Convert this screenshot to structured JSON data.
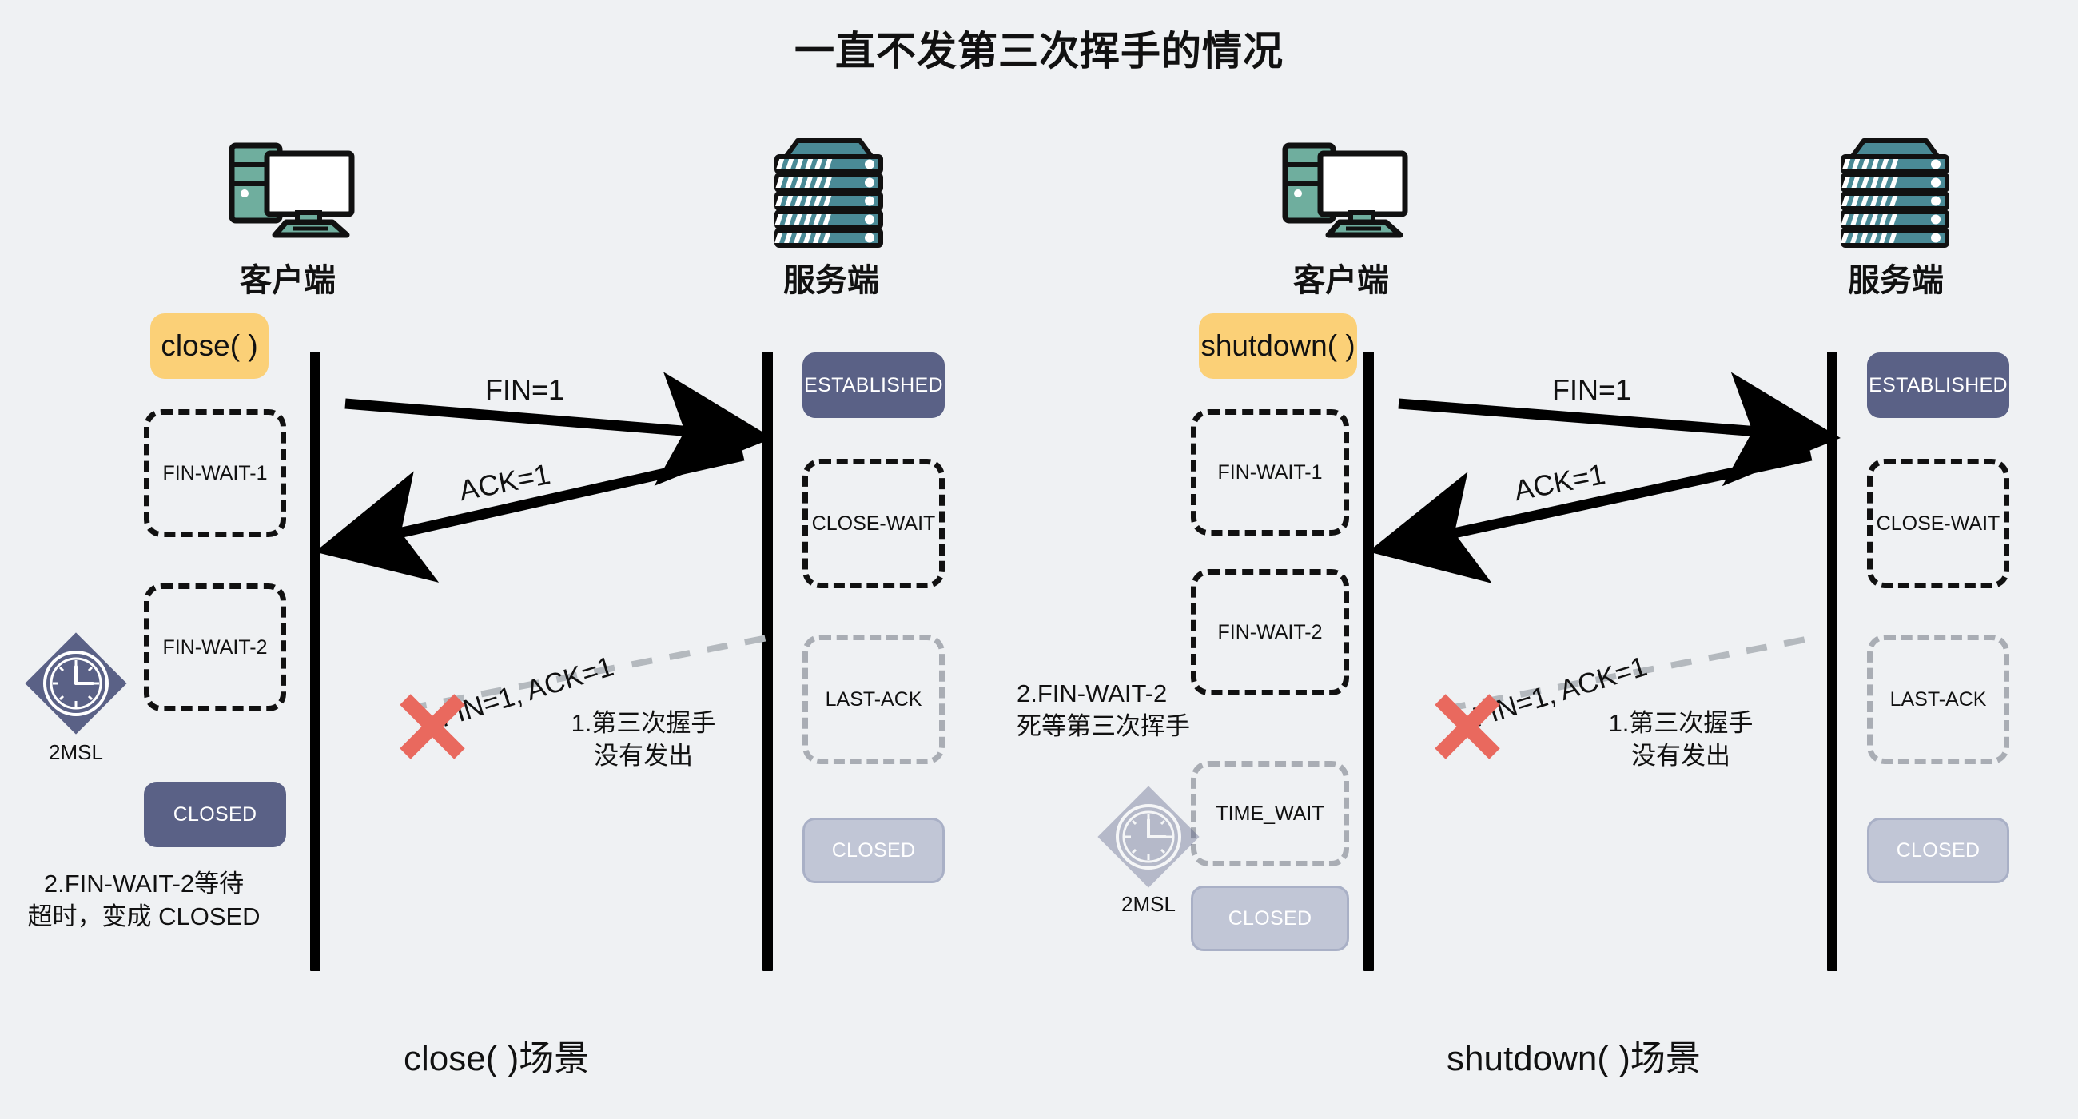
{
  "title": "一直不发第三次挥手的情况",
  "colors": {
    "background": "#eff1f3",
    "action_box": "#fbd077",
    "state_active": "#5a6186",
    "state_faded": "#c1c6d6",
    "dashed_active": "#111111",
    "dashed_muted": "#a9adb4",
    "cross_red": "#e9695e",
    "device_teal": "#6fae9e",
    "server_teal": "#4a8a96",
    "lifeline": "#000000"
  },
  "panels": [
    {
      "id": "close-scenario",
      "caption": "close( )场景",
      "client": {
        "label": "客户端",
        "icon": "desktop-computer-icon",
        "action": "close( )",
        "states": [
          {
            "name": "FIN-WAIT-1",
            "style": "dashed-active"
          },
          {
            "name": "FIN-WAIT-2",
            "style": "dashed-active"
          },
          {
            "name": "CLOSED",
            "style": "solid-active"
          }
        ],
        "timer": {
          "label": "2MSL",
          "icon": "clock-diamond-icon",
          "ghost": false
        },
        "note": [
          "2.FIN-WAIT-2等待",
          "超时，变成 CLOSED"
        ]
      },
      "server": {
        "label": "服务端",
        "icon": "server-rack-icon",
        "states": [
          {
            "name": "ESTABLISHED",
            "style": "solid-active"
          },
          {
            "name": "CLOSE-WAIT",
            "style": "dashed-active"
          },
          {
            "name": "LAST-ACK",
            "style": "dashed-muted"
          },
          {
            "name": "CLOSED",
            "style": "solid-faded"
          }
        ]
      },
      "messages": [
        {
          "label": "FIN=1",
          "direction": "client-to-server",
          "style": "solid"
        },
        {
          "label": "ACK=1",
          "direction": "server-to-client",
          "style": "solid"
        },
        {
          "label": "FIN=1, ACK=1",
          "direction": "server-to-client",
          "style": "dashed-blocked",
          "blocked": true
        }
      ],
      "blocked_note": [
        "1.第三次握手",
        "没有发出"
      ],
      "cross_icon": "red-cross-icon"
    },
    {
      "id": "shutdown-scenario",
      "caption": "shutdown( )场景",
      "client": {
        "label": "客户端",
        "icon": "desktop-computer-icon",
        "action": "shutdown( )",
        "states": [
          {
            "name": "FIN-WAIT-1",
            "style": "dashed-active"
          },
          {
            "name": "FIN-WAIT-2",
            "style": "dashed-active"
          },
          {
            "name": "TIME_WAIT",
            "style": "dashed-muted"
          },
          {
            "name": "CLOSED",
            "style": "solid-faded"
          }
        ],
        "timer": {
          "label": "2MSL",
          "icon": "clock-diamond-icon",
          "ghost": true
        },
        "note": [
          "2.FIN-WAIT-2",
          "死等第三次挥手"
        ]
      },
      "server": {
        "label": "服务端",
        "icon": "server-rack-icon",
        "states": [
          {
            "name": "ESTABLISHED",
            "style": "solid-active"
          },
          {
            "name": "CLOSE-WAIT",
            "style": "dashed-active"
          },
          {
            "name": "LAST-ACK",
            "style": "dashed-muted"
          },
          {
            "name": "CLOSED",
            "style": "solid-faded"
          }
        ]
      },
      "messages": [
        {
          "label": "FIN=1",
          "direction": "client-to-server",
          "style": "solid"
        },
        {
          "label": "ACK=1",
          "direction": "server-to-client",
          "style": "solid"
        },
        {
          "label": "FIN=1, ACK=1",
          "direction": "server-to-client",
          "style": "dashed-blocked",
          "blocked": true
        }
      ],
      "blocked_note": [
        "1.第三次握手",
        "没有发出"
      ],
      "cross_icon": "red-cross-icon"
    }
  ]
}
